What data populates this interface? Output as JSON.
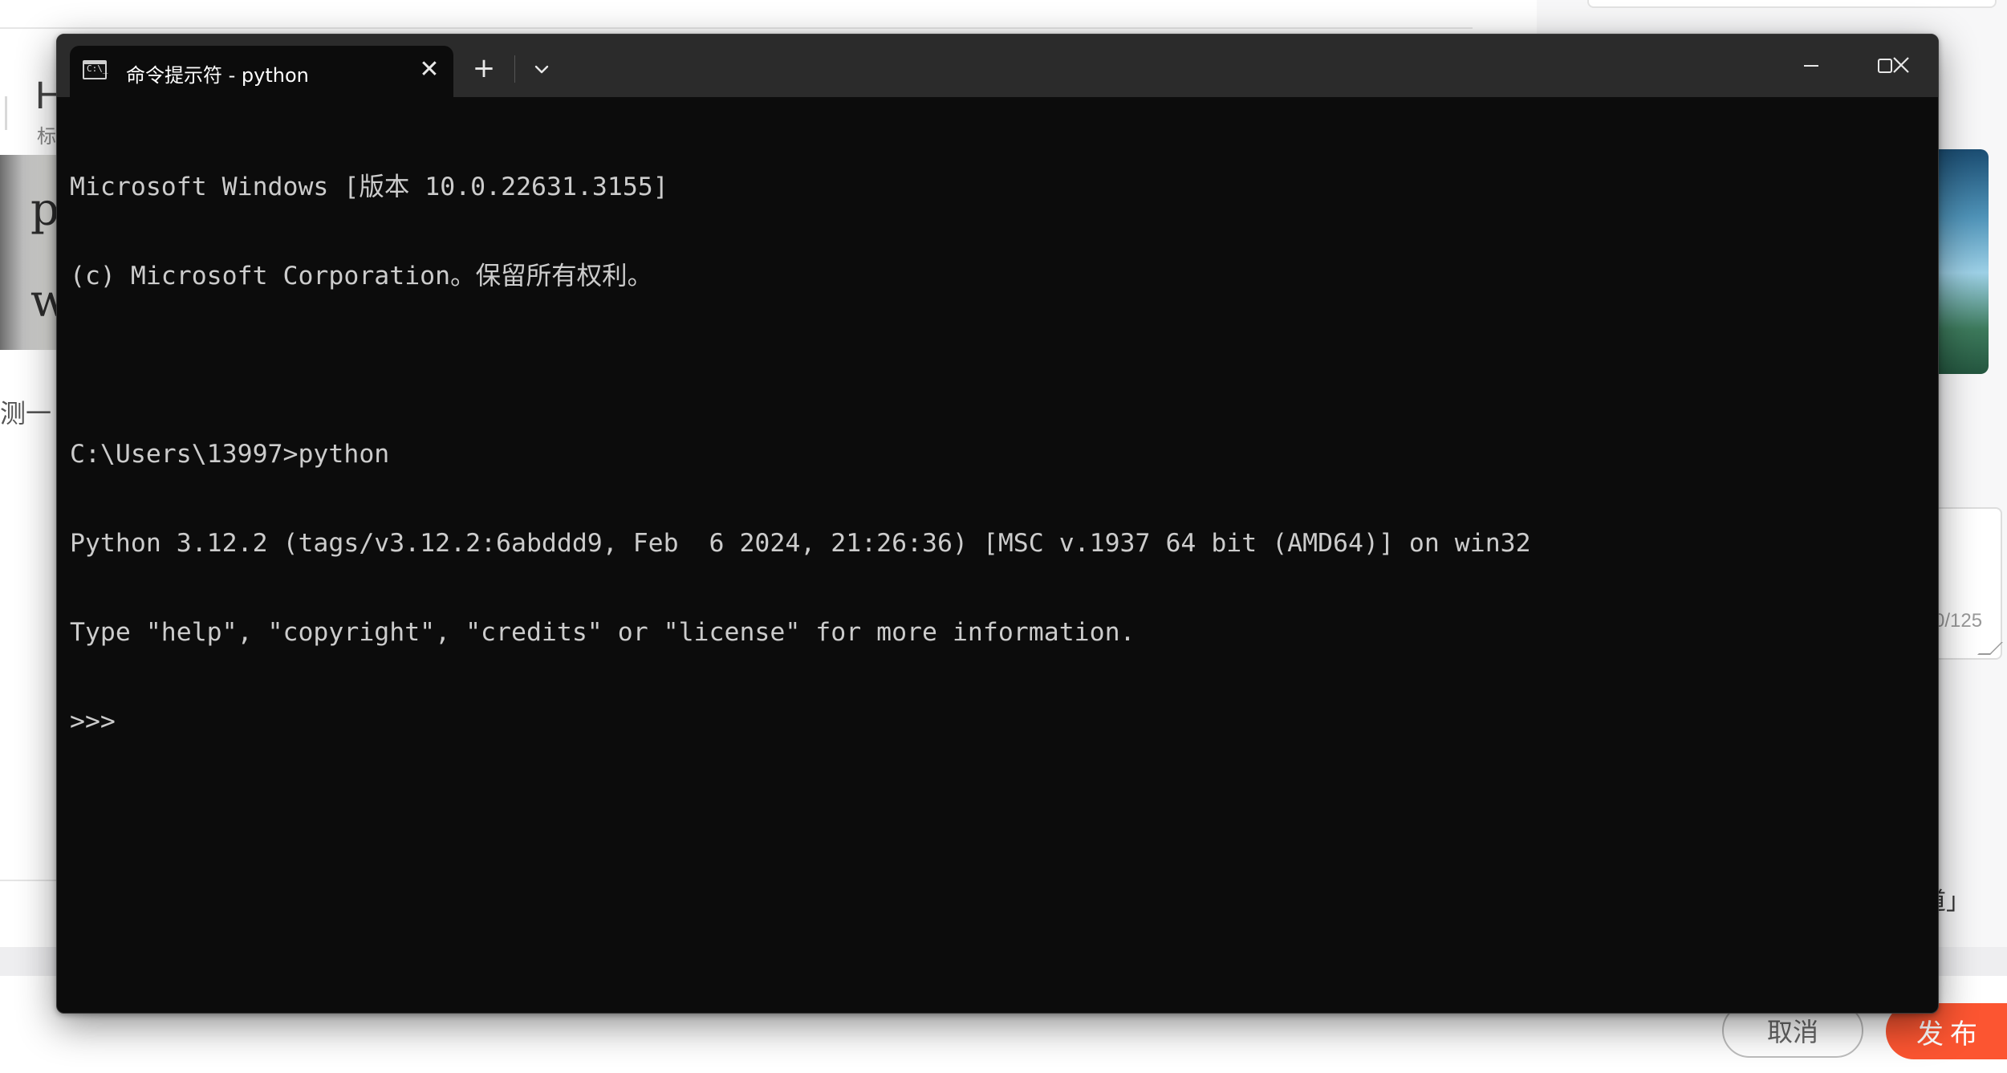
{
  "background_page": {
    "heading_fragment": "H",
    "subheading_fragment": "标",
    "thumbnail_text_fragments": [
      "p",
      "w"
    ],
    "body_text_fragment": "测一",
    "char_counter": "0/125",
    "channel_fragment": "道」",
    "cancel_label": "取消",
    "publish_label": "发布",
    "accent_color": "#fc5531"
  },
  "terminal": {
    "tab_title": "命令提示符 - python",
    "tab_icon_text": "C:\\_",
    "close_tab_glyph": "✕",
    "new_tab_glyph": "+",
    "dropdown_icon": "chevron-down-icon",
    "window_controls": [
      "minimize-icon",
      "maximize-icon",
      "close-icon"
    ],
    "background_color": "#0c0c0c",
    "text_color": "#cccccc",
    "lines": [
      "Microsoft Windows [版本 10.0.22631.3155]",
      "(c) Microsoft Corporation。保留所有权利。",
      "",
      "C:\\Users\\13997>python",
      "Python 3.12.2 (tags/v3.12.2:6abddd9, Feb  6 2024, 21:26:36) [MSC v.1937 64 bit (AMD64)] on win32",
      "Type \"help\", \"copyright\", \"credits\" or \"license\" for more information.",
      ">>> "
    ]
  }
}
